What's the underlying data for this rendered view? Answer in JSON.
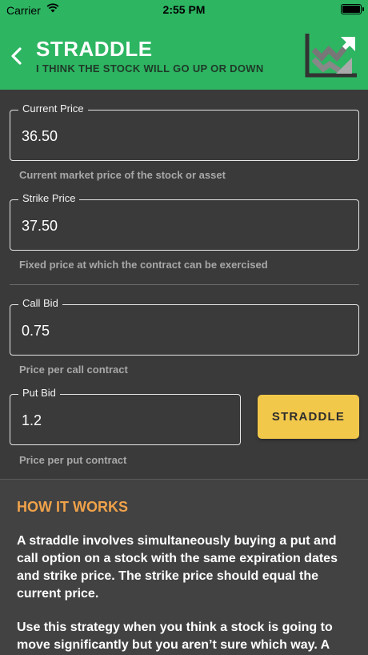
{
  "status": {
    "carrier": "Carrier",
    "time": "2:55 PM"
  },
  "header": {
    "title": "STRADDLE",
    "subtitle": "I THINK THE STOCK WILL GO UP OR DOWN"
  },
  "colors": {
    "header": "#2db562",
    "button": "#f2c84b",
    "accent": "#f0a24a",
    "background": "#3a3a3a"
  },
  "fields": {
    "current_price": {
      "label": "Current Price",
      "value": "36.50",
      "helper": "Current market price of the stock or asset"
    },
    "strike_price": {
      "label": "Strike Price",
      "value": "37.50",
      "helper": "Fixed price at which the contract can be exercised"
    },
    "call_bid": {
      "label": "Call Bid",
      "value": "0.75",
      "helper": "Price per call contract"
    },
    "put_bid": {
      "label": "Put Bid",
      "value": "1.2",
      "helper": "Price per put contract"
    }
  },
  "button": {
    "label": "STRADDLE"
  },
  "how_it_works": {
    "title": "HOW IT WORKS",
    "p1": "A straddle involves simultaneously buying a put and call option on a stock with the same expiration dates and strike price. The strike price should equal the current price.",
    "p2": "Use this strategy when you think a stock is going to move significantly but you aren’t sure which way. A day or it goes up for...yer(s) with..."
  },
  "icons": {
    "back": "chevron-left-icon",
    "logo": "chart-arrows-icon",
    "wifi": "wifi-icon",
    "battery": "battery-icon"
  }
}
